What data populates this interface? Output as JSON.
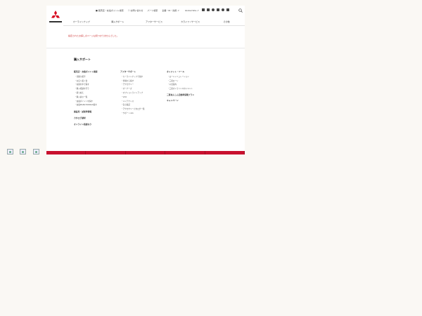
{
  "header": {
    "utility": [
      {
        "label": "■ 販売店・充電ポイント検索"
      },
      {
        "label": "☐ お問い合わせ"
      },
      {
        "label": "パーツ検索"
      },
      {
        "label": "企業・IR・採用 ⇗"
      }
    ],
    "lang": "Global Site ⇗",
    "nav": [
      {
        "label": "カーラインナップ"
      },
      {
        "label": "購入サポート"
      },
      {
        "label": "アフターサービス"
      },
      {
        "label": "カライフ / サービス"
      },
      {
        "label": "その他"
      }
    ]
  },
  "main": {
    "error": "指定されたお探しのページは見つかりませんでした。"
  },
  "footer": {
    "title": "購入サポート",
    "col1": {
      "head": "販売店・充電ポイント検索",
      "items": [
        "・見積り相手",
        "・お店へ着く会",
        "・在庫を車で探す",
        "・購入相談を行う",
        "・乗り換え",
        "・購入前の一覧",
        "・充電ポイントを探す",
        "・充電MAP&TORIKAS探す"
      ],
      "sections": [
        "施設見・試乗車情報",
        "カタログ請求",
        "オンライン商談なり"
      ]
    },
    "col2": {
      "head": "アフターサポート",
      "items": [
        "・カーラインナップで探す",
        "・車種から探す",
        "・アクセサリー",
        "・オーナーズ",
        "・オプションラインアップ",
        "・VCO",
        "・メンテナンス",
        "・安心保証",
        "・アクセサリーカタログ一覧",
        "・サポートinfo"
      ]
    },
    "col3": {
      "head": "オレジット・ツール",
      "items": [
        "・ローンシミュレーション",
        "・三菱ローン",
        "・公式案内",
        "・三菱オンラインマネジメント"
      ],
      "sections": [
        "三菱あんしん自動車保険プラン",
        "キャンペーン"
      ]
    }
  },
  "images": [
    {
      "alt": ""
    },
    {
      "alt": ""
    },
    {
      "alt": ""
    }
  ]
}
